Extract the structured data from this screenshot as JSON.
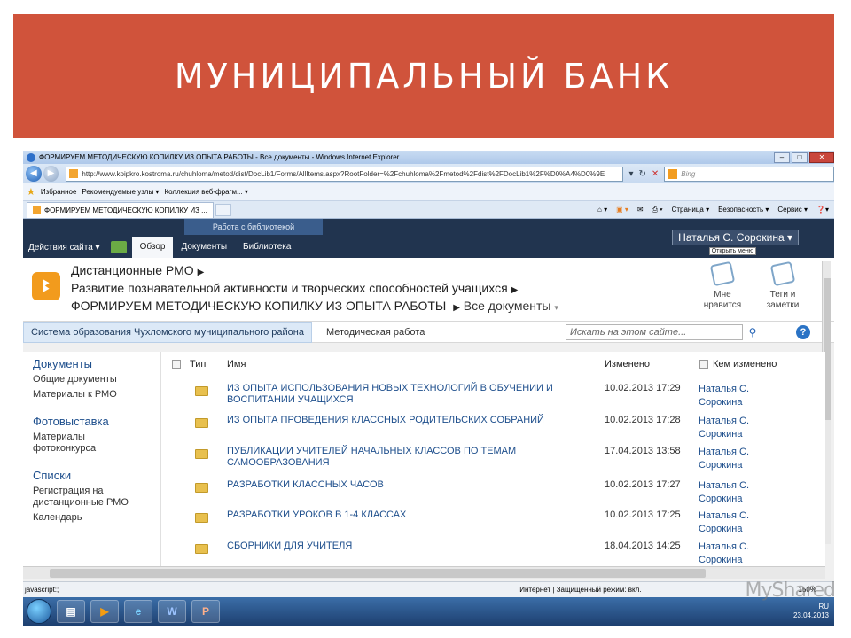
{
  "slide": {
    "title": "МУНИЦИПАЛЬНЫЙ БАНК"
  },
  "browser": {
    "window_title": "ФОРМИРУЕМ МЕТОДИЧЕСКУЮ КОПИЛКУ ИЗ ОПЫТА РАБОТЫ - Все документы - Windows Internet Explorer",
    "address": "http://www.koipkro.kostroma.ru/chuhloma/metod/dist/DocLib1/Forms/AllItems.aspx?RootFolder=%2Fchuhloma%2Fmetod%2Fdist%2FDocLib1%2F%D0%A4%D0%9E",
    "search_placeholder": "Bing",
    "favorites_label": "Избранное",
    "fav_links": [
      "Рекомендуемые узлы ▾",
      "Коллекция веб-фрагм... ▾"
    ],
    "tab_label": "ФОРМИРУЕМ МЕТОДИЧЕСКУЮ КОПИЛКУ ИЗ ...",
    "command_bar": [
      "Страница ▾",
      "Безопасность ▾",
      "Сервис ▾"
    ],
    "status_left": "javascript:;",
    "status_mid": "Интернет | Защищенный режим: вкл.",
    "zoom": "150%"
  },
  "ribbon": {
    "group_label": "Работа с библиотекой",
    "site_actions": "Действия сайта ▾",
    "tabs": [
      "Обзор",
      "Документы",
      "Библиотека"
    ],
    "user": "Наталья С. Сорокина ▾",
    "tooltip": "Открыть меню"
  },
  "titlearea": {
    "breadcrumb1": "Дистанционные РМО",
    "breadcrumb2": "Развитие познавательной активности и творческих способностей учащихся",
    "list_title": "ФОРМИРУЕМ МЕТОДИЧЕСКУЮ КОПИЛКУ ИЗ ОПЫТА РАБОТЫ",
    "view": "Все документы",
    "like_label": "Мне нравится",
    "tags_label": "Теги и заметки"
  },
  "topnav": {
    "items": [
      "Система образования Чухломского муниципального района",
      "Методическая работа"
    ],
    "search_placeholder": "Искать на этом сайте..."
  },
  "quicklaunch": {
    "sections": [
      {
        "heading": "Документы",
        "items": [
          "Общие документы",
          "Материалы к РМО"
        ]
      },
      {
        "heading": "Фотовыставка",
        "items": [
          "Материалы фотоконкурса"
        ]
      },
      {
        "heading": "Списки",
        "items": [
          "Регистрация на дистанционные РМО",
          "Календарь"
        ]
      }
    ]
  },
  "list": {
    "headers": {
      "type": "Тип",
      "name": "Имя",
      "modified": "Изменено",
      "modified_by": "Кем изменено"
    },
    "rows": [
      {
        "name": "ИЗ ОПЫТА ИСПОЛЬЗОВАНИЯ НОВЫХ ТЕХНОЛОГИЙ В ОБУЧЕНИИ И ВОСПИТАНИИ УЧАЩИХСЯ",
        "modified": "10.02.2013 17:29",
        "by": "Наталья С. Сорокина"
      },
      {
        "name": "ИЗ ОПЫТА ПРОВЕДЕНИЯ КЛАССНЫХ РОДИТЕЛЬСКИХ СОБРАНИЙ",
        "modified": "10.02.2013 17:28",
        "by": "Наталья С. Сорокина"
      },
      {
        "name": "ПУБЛИКАЦИИ УЧИТЕЛЕЙ НАЧАЛЬНЫХ КЛАССОВ ПО ТЕМАМ САМООБРАЗОВАНИЯ",
        "modified": "17.04.2013 13:58",
        "by": "Наталья С. Сорокина"
      },
      {
        "name": "РАЗРАБОТКИ КЛАССНЫХ ЧАСОВ",
        "modified": "10.02.2013 17:27",
        "by": "Наталья С. Сорокина"
      },
      {
        "name": "РАЗРАБОТКИ УРОКОВ В 1-4 КЛАССАХ",
        "modified": "10.02.2013 17:25",
        "by": "Наталья С. Сорокина"
      },
      {
        "name": "СБОРНИКИ ДЛЯ УЧИТЕЛЯ",
        "modified": "18.04.2013 14:25",
        "by": "Наталья С. Сорокина"
      }
    ]
  },
  "taskbar": {
    "tray_lang": "RU",
    "date": "23.04.2013"
  },
  "watermark": "MyShared"
}
